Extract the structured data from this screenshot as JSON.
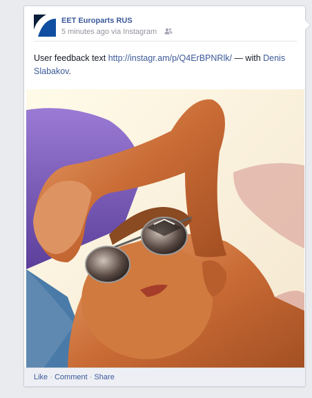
{
  "post": {
    "author": "EET Europarts RUS",
    "time": "5 minutes ago",
    "via_prefix": "via",
    "via": "Instagram",
    "privacy_icon": "friends-icon",
    "message": {
      "text": "User feedback text",
      "link": "http://instagr.am/p/Q4ErBPNRlk/",
      "with_prefix": "— with",
      "tagged": "Denis Slabakov",
      "end": "."
    }
  },
  "actions": {
    "like": "Like",
    "sep": "·",
    "comment": "Comment",
    "share": "Share"
  },
  "colors": {
    "link": "#3b5998",
    "muted": "#90949c",
    "footer_bg": "#edeff4",
    "brand": "#0f4ea0"
  }
}
